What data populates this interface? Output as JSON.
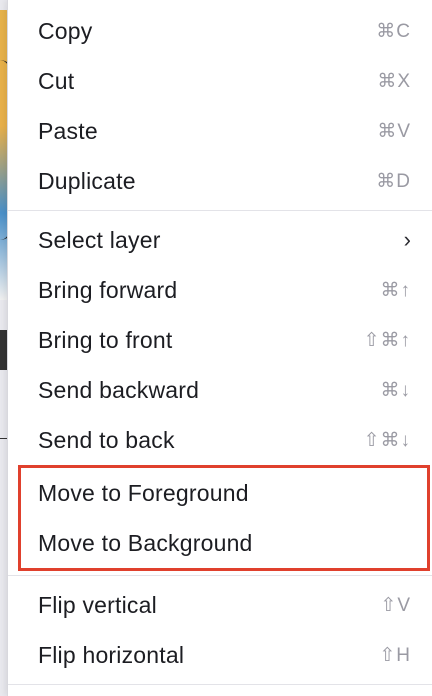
{
  "menu": {
    "clipboard": [
      {
        "label": "Copy",
        "shortcut": "⌘C"
      },
      {
        "label": "Cut",
        "shortcut": "⌘X"
      },
      {
        "label": "Paste",
        "shortcut": "⌘V"
      },
      {
        "label": "Duplicate",
        "shortcut": "⌘D"
      }
    ],
    "arrange": [
      {
        "label": "Select layer",
        "shortcut": "›"
      },
      {
        "label": "Bring forward",
        "shortcut": "⌘↑"
      },
      {
        "label": "Bring to front",
        "shortcut": "⇧⌘↑"
      },
      {
        "label": "Send backward",
        "shortcut": "⌘↓"
      },
      {
        "label": "Send to back",
        "shortcut": "⇧⌘↓"
      }
    ],
    "highlighted": [
      {
        "label": "Move to Foreground"
      },
      {
        "label": "Move to Background"
      }
    ],
    "flip": [
      {
        "label": "Flip vertical",
        "shortcut": "⇧V"
      },
      {
        "label": "Flip horizontal",
        "shortcut": "⇧H"
      }
    ]
  },
  "colors": {
    "highlight_border": "#e0402d",
    "text": "#1c1d22",
    "shortcut": "#9a9aa3"
  }
}
